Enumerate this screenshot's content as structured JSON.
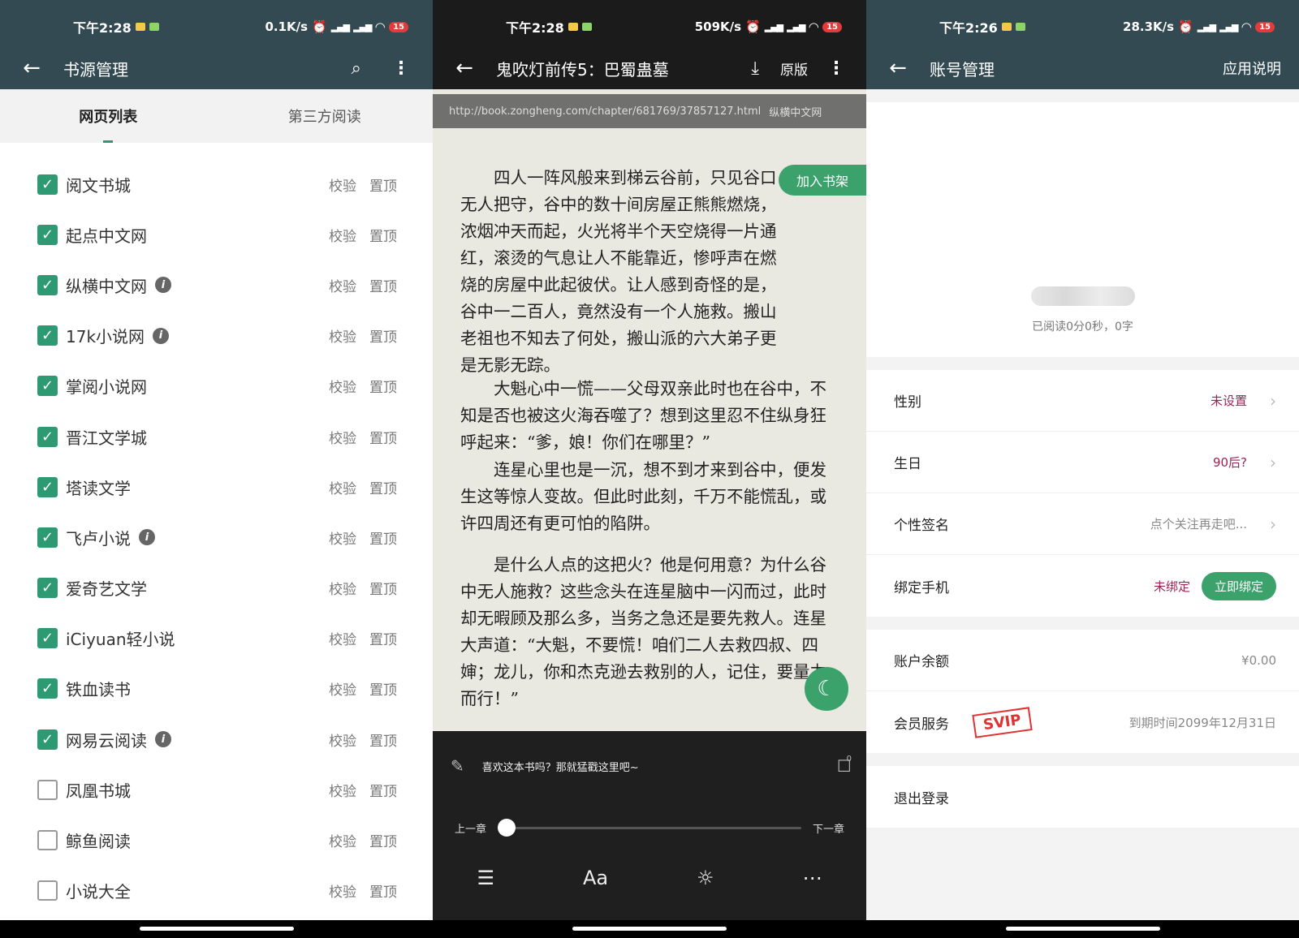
{
  "screen1": {
    "status": {
      "time": "下午2:28",
      "speed": "0.1K/s",
      "badge": "15"
    },
    "title": "书源管理",
    "tabs": [
      "网页列表",
      "第三方阅读"
    ],
    "actions": {
      "verify": "校验",
      "pin": "置顶"
    },
    "sources": [
      {
        "name": "阅文书城",
        "checked": true,
        "info": false
      },
      {
        "name": "起点中文网",
        "checked": true,
        "info": false
      },
      {
        "name": "纵横中文网",
        "checked": true,
        "info": true
      },
      {
        "name": "17k小说网",
        "checked": true,
        "info": true
      },
      {
        "name": "掌阅小说网",
        "checked": true,
        "info": false
      },
      {
        "name": "晋江文学城",
        "checked": true,
        "info": false
      },
      {
        "name": "塔读文学",
        "checked": true,
        "info": false
      },
      {
        "name": "飞卢小说",
        "checked": true,
        "info": true
      },
      {
        "name": "爱奇艺文学",
        "checked": true,
        "info": false
      },
      {
        "name": "iCiyuan轻小说",
        "checked": true,
        "info": false
      },
      {
        "name": "铁血读书",
        "checked": true,
        "info": false
      },
      {
        "name": "网易云阅读",
        "checked": true,
        "info": true
      },
      {
        "name": "凤凰书城",
        "checked": false,
        "info": false
      },
      {
        "name": "鲸鱼阅读",
        "checked": false,
        "info": false
      },
      {
        "name": "小说大全",
        "checked": false,
        "info": false
      }
    ]
  },
  "screen2": {
    "status": {
      "time": "下午2:28",
      "speed": "509K/s",
      "badge": "15"
    },
    "title": "鬼吹灯前传5：巴蜀蛊墓",
    "original_label": "原版",
    "url": "http://book.zongheng.com/chapter/681769/37857127.html",
    "site": "纵横中文网",
    "add_shelf": "加入书架",
    "paragraphs": [
      "四人一阵风般来到梯云谷前，只见谷口无人把守，谷中的数十间房屋正熊熊燃烧，浓烟冲天而起，火光将半个天空烧得一片通红，滚烫的气息让人不能靠近，惨呼声在燃烧的房屋中此起彼伏。让人感到奇怪的是，谷中一二百人，竟然没有一个人施救。搬山老祖也不知去了何处，搬山派的六大弟子更是无影无踪。",
      "大魁心中一慌——父母双亲此时也在谷中，不知是否也被这火海吞噬了？想到这里忍不住纵身狂呼起来：“爹，娘！你们在哪里？”",
      "连星心里也是一沉，想不到才来到谷中，便发生这等惊人变故。但此时此刻，千万不能慌乱，或许四周还有更可怕的陷阱。",
      "是什么人点的这把火？他是何用意？为什么谷中无人施救？这些念头在连星脑中一闪而过，此时却无暇顾及那么多，当务之急还是要先救人。连星大声道：“大魁，不要慌！咱们二人去救四叔、四婶；龙儿，你和杰克逊去救别的人，记住，要量力而行！”"
    ],
    "comment_prompt": "喜欢这本书吗？那就猛戳这里吧~",
    "comment_count": "0",
    "prev_chapter": "上一章",
    "next_chapter": "下一章",
    "progress": 0.0,
    "font_label": "Aa"
  },
  "screen3": {
    "status": {
      "time": "下午2:26",
      "speed": "28.3K/s",
      "badge": "15"
    },
    "title": "账号管理",
    "help": "应用说明",
    "read_stat": "已阅读0分0秒，0字",
    "rows": {
      "gender": {
        "label": "性别",
        "value": "未设置"
      },
      "birthday": {
        "label": "生日",
        "value": "90后?"
      },
      "signature": {
        "label": "个性签名",
        "value": "点个关注再走吧..."
      },
      "phone": {
        "label": "绑定手机",
        "value": "未绑定",
        "button": "立即绑定"
      },
      "balance": {
        "label": "账户余额",
        "value": "¥0.00"
      },
      "vip": {
        "label": "会员服务",
        "stamp": "SVIP",
        "value": "到期时间2099年12月31日"
      }
    },
    "logout": "退出登录"
  },
  "colors": {
    "appbar": "#334a53",
    "accent": "#2e9a73",
    "pink": "#9c2258"
  }
}
